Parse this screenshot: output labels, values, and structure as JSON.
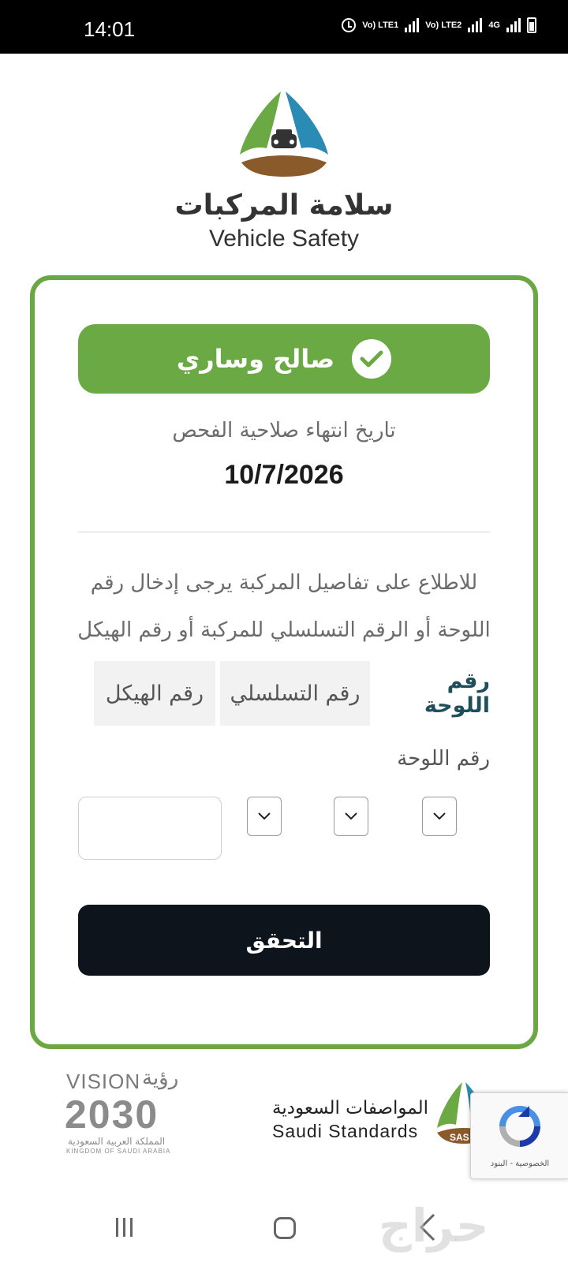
{
  "status_bar": {
    "time": "14:01",
    "sim1": "Vo) LTE1",
    "sim2": "Vo) LTE2",
    "net": "4G"
  },
  "header": {
    "brand_ar": "سلامة المركبات",
    "brand_en": "Vehicle Safety",
    "logo_colors": [
      "#6aa944",
      "#2a8bb5",
      "#8a5a2b"
    ]
  },
  "result": {
    "status_label": "صالح وساري",
    "status_color": "#6aa944",
    "expiry_label": "تاريخ انتهاء صلاحية الفحص",
    "expiry_date": "10/7/2026"
  },
  "lookup": {
    "instructions": "للاطلاع على تفاصيل المركبة يرجى إدخال رقم اللوحة أو الرقم التسلسلي للمركبة أو رقم الهيكل",
    "tabs": [
      {
        "label": "رقم اللوحة",
        "active": true
      },
      {
        "label": "رقم التسلسلي",
        "active": false
      },
      {
        "label": "رقم الهيكل",
        "active": false
      }
    ],
    "field_label": "رقم اللوحة",
    "plate_number_value": "",
    "verify_label": "التحقق"
  },
  "footer": {
    "vision_top_en": "VISION",
    "vision_top_ar": "رؤية",
    "vision_year": "2030",
    "vision_ar_bottom": "المملكة العربية السعودية",
    "vision_en_bottom": "KINGDOM OF SAUDI ARABIA",
    "sasa_ar": "المواصفات السعودية",
    "sasa_en": "Saudi Standards",
    "sasa_badge": "SAS",
    "recaptcha_links": "الخصوصية - البنود"
  },
  "watermark": "حراج"
}
